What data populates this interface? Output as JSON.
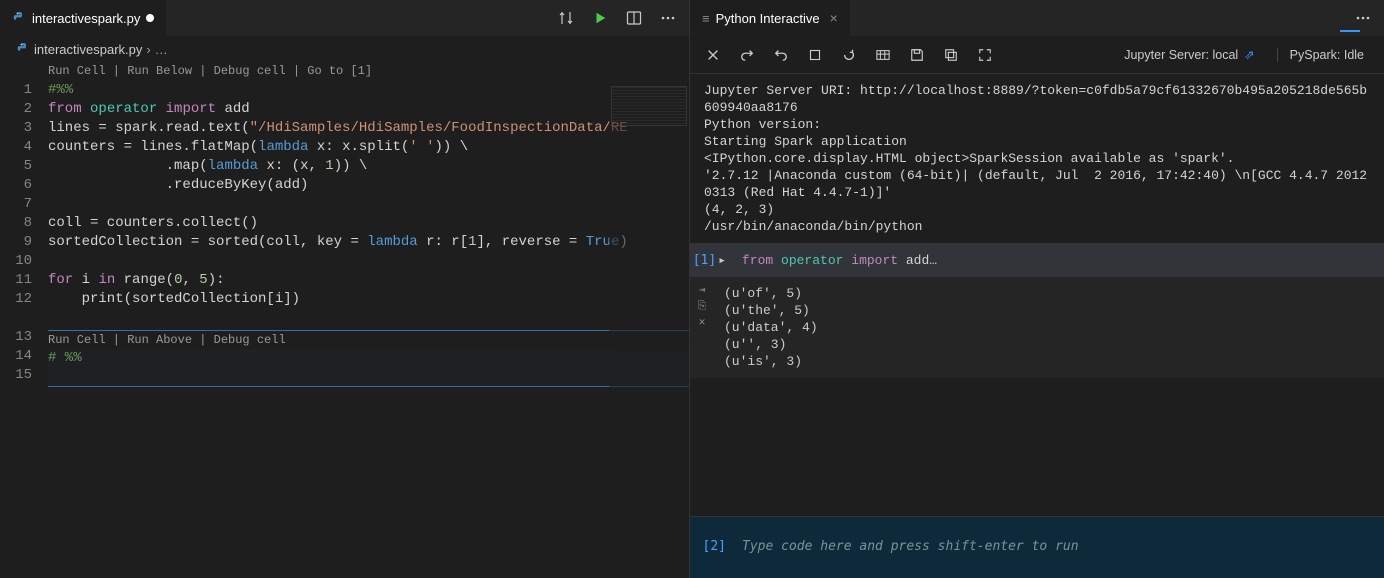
{
  "editor": {
    "tab_title": "interactivespark.py",
    "tab_dirty": true,
    "breadcrumb_file": "interactivespark.py",
    "breadcrumb_more": "…",
    "codelens1": "Run Cell | Run Below | Debug cell | Go to [1]",
    "codelens2": "Run Cell | Run Above | Debug cell",
    "lines": [
      {
        "n": "1",
        "raw": "#%%",
        "cls": "cmt"
      },
      {
        "n": "2",
        "raw": ""
      },
      {
        "n": "3",
        "raw": ""
      },
      {
        "n": "4",
        "raw": ""
      },
      {
        "n": "5",
        "raw": ""
      },
      {
        "n": "6",
        "raw": ""
      },
      {
        "n": "7",
        "raw": ""
      },
      {
        "n": "8",
        "raw": ""
      },
      {
        "n": "9",
        "raw": ""
      },
      {
        "n": "10",
        "raw": ""
      },
      {
        "n": "11",
        "raw": ""
      },
      {
        "n": "12",
        "raw": ""
      },
      {
        "n": "13",
        "raw": ""
      },
      {
        "n": "14",
        "raw": "# %%",
        "cls": "cmt"
      },
      {
        "n": "15",
        "raw": ""
      }
    ],
    "code_tokens": {
      "l2": {
        "from": "from",
        "op": "operator",
        "import": "import",
        "add": "add"
      },
      "l3": {
        "a": "lines = spark.read.text(",
        "s": "\"/HdiSamples/HdiSamples/FoodInspectionData/RE",
        "b": ""
      },
      "l4": {
        "a": "counters = lines.flatMap(",
        "kw": "lambda",
        "b": " x: x.split(",
        "s": "' '",
        "c": ")) \\"
      },
      "l5": {
        "a": "              .map(",
        "kw": "lambda",
        "b": " x: (x, ",
        "n": "1",
        "c": ")) \\"
      },
      "l6": {
        "a": "              .reduceByKey(add)"
      },
      "l8": {
        "a": "coll = counters.collect()"
      },
      "l9": {
        "a": "sortedCollection = sorted(coll, key = ",
        "kw": "lambda",
        "b": " r: r[",
        "n": "1",
        "c": "], reverse = ",
        "t": "True",
        "d": ")"
      },
      "l11": {
        "for": "for",
        "a": " i ",
        "in": "in",
        "b": " range(",
        "n1": "0",
        "c": ", ",
        "n2": "5",
        "d": "):"
      },
      "l12": {
        "a": "    print(sortedCollection[i])"
      }
    }
  },
  "interactive": {
    "tab_title": "Python Interactive",
    "server_label": "Jupyter Server: local",
    "pyspark_label": "PySpark: Idle",
    "startup_output": "Jupyter Server URI: http://localhost:8889/?token=c0fdb5a79cf61332670b495a205218de565b609940aa8176\nPython version:\nStarting Spark application\n<IPython.core.display.HTML object>SparkSession available as 'spark'.\n'2.7.12 |Anaconda custom (64-bit)| (default, Jul  2 2016, 17:42:40) \\n[GCC 4.4.7 20120313 (Red Hat 4.4.7-1)]'\n(4, 2, 3)\n/usr/bin/anaconda/bin/python",
    "cell1_prompt": "[1]",
    "cell1_code": {
      "from": "from",
      "op": "operator",
      "import": "import",
      "tail": " add…"
    },
    "cell1_output": "(u'of', 5)\n(u'the', 5)\n(u'data', 4)\n(u'', 3)\n(u'is', 3)",
    "input_prompt": "[2]",
    "input_placeholder": "Type code here and press shift-enter to run"
  }
}
